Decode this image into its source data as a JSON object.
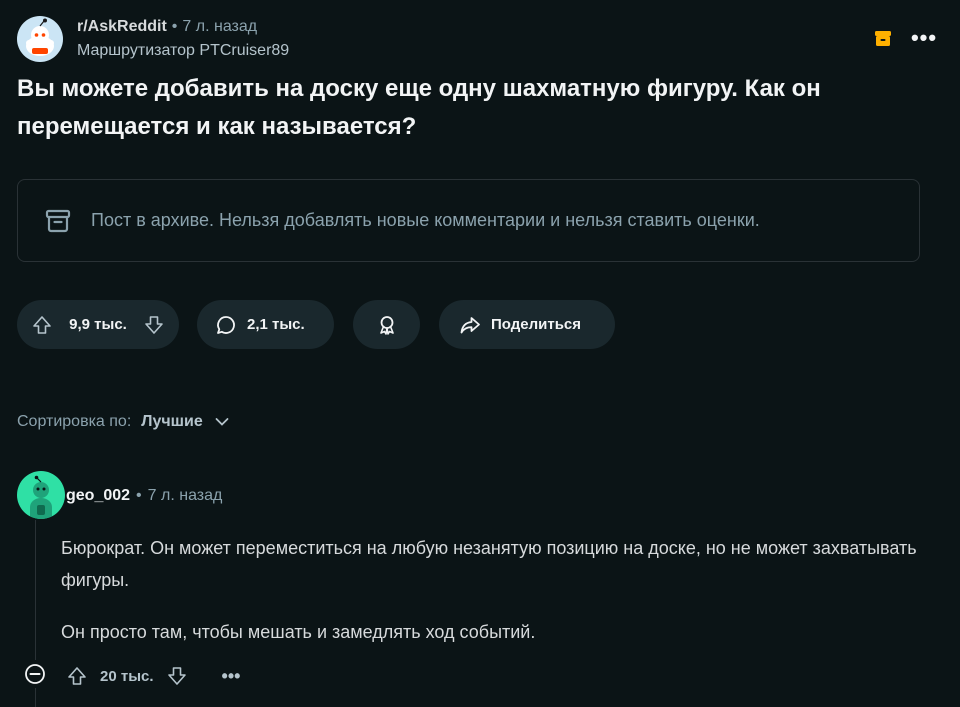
{
  "post": {
    "subreddit": "r/AskReddit",
    "separator": "•",
    "time": "7 л. назад",
    "author": "Маршрутизатор PTCruiser89",
    "more_label": "•••",
    "title": "Вы можете добавить на доску еще одну шахматную фигуру. Как он перемещается и как называется?"
  },
  "notice": {
    "icon": "archive-icon",
    "text": "Пост в архиве. Нельзя добавлять новые комментарии и нельзя ставить оценки."
  },
  "actions": {
    "score": "9,9 тыс.",
    "comments": "2,1 тыс.",
    "share_label": "Поделиться"
  },
  "sort": {
    "label": "Сортировка по:",
    "value": "Лучшие"
  },
  "comment": {
    "username": "geo_002",
    "separator": "•",
    "time": "7 л. назад",
    "paragraphs": [
      "Бюрократ. Он может переместиться на любую незанятую позицию на доске, но не может захватывать фигуры.",
      "Он просто там, чтобы мешать и замедлять ход событий."
    ],
    "score": "20 тыс.",
    "more_label": "•••"
  },
  "colors": {
    "background": "#0b1416",
    "pill": "#1a282d",
    "archive_badge": "#ffb000",
    "muted_text": "#8ba2ad",
    "comment_avatar": "#2fe0a5",
    "subreddit_avatar": "#cbe5f5"
  }
}
